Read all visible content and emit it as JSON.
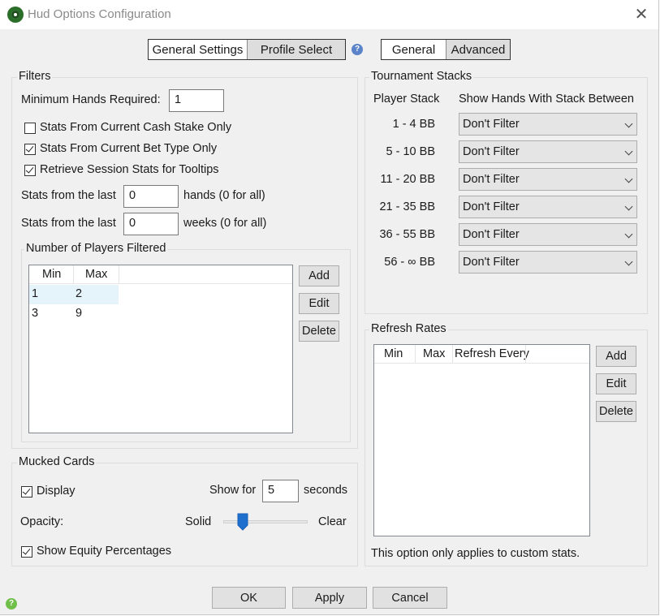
{
  "window": {
    "title": "Hud Options Configuration",
    "close_label": "✕"
  },
  "tabs_left": [
    {
      "label": "General Settings",
      "active": false
    },
    {
      "label": "Profile Select",
      "active": true
    }
  ],
  "tabs_right": [
    {
      "label": "General",
      "active": false
    },
    {
      "label": "Advanced",
      "active": true
    }
  ],
  "help_glyph": "?",
  "filters": {
    "title": "Filters",
    "min_hands_label": "Minimum Hands Required:",
    "min_hands_value": "1",
    "checkboxes": [
      {
        "label": "Stats From Current Cash Stake Only",
        "checked": false
      },
      {
        "label": "Stats From Current Bet Type Only",
        "checked": true
      },
      {
        "label": "Retrieve Session Stats for Tooltips",
        "checked": true
      }
    ],
    "last_hands_prefix": "Stats from the last",
    "last_hands_value": "0",
    "last_hands_suffix": "hands (0 for all)",
    "last_weeks_prefix": "Stats from the last",
    "last_weeks_value": "0",
    "last_weeks_suffix": "weeks (0 for all)"
  },
  "players_filtered": {
    "title": "Number of Players Filtered",
    "columns": [
      "Min",
      "Max"
    ],
    "rows": [
      {
        "min": "1",
        "max": "2",
        "selected": true
      },
      {
        "min": "3",
        "max": "9",
        "selected": false
      }
    ],
    "add": "Add",
    "edit": "Edit",
    "delete": "Delete"
  },
  "mucked": {
    "title": "Mucked Cards",
    "display_label": "Display",
    "display_checked": true,
    "show_for_label": "Show for",
    "show_for_value": "5",
    "seconds_label": "seconds",
    "opacity_label": "Opacity:",
    "solid_label": "Solid",
    "clear_label": "Clear",
    "opacity_fraction": 0.24,
    "equity_label": "Show Equity Percentages",
    "equity_checked": true
  },
  "tournament": {
    "title": "Tournament Stacks",
    "col_stack": "Player Stack",
    "col_show": "Show Hands With Stack Between",
    "rows": [
      {
        "stack": "1 - 4 BB",
        "value": "Don't Filter"
      },
      {
        "stack": "5 - 10 BB",
        "value": "Don't Filter"
      },
      {
        "stack": "11 - 20 BB",
        "value": "Don't Filter"
      },
      {
        "stack": "21 - 35 BB",
        "value": "Don't Filter"
      },
      {
        "stack": "36 - 55 BB",
        "value": "Don't Filter"
      },
      {
        "stack": "56 - ∞ BB",
        "value": "Don't Filter"
      }
    ]
  },
  "refresh": {
    "title": "Refresh Rates",
    "columns": [
      "Min",
      "Max",
      "Refresh Every"
    ],
    "add": "Add",
    "edit": "Edit",
    "delete": "Delete",
    "note": "This option only applies to custom stats."
  },
  "footer": {
    "ok": "OK",
    "apply": "Apply",
    "cancel": "Cancel",
    "status_glyph": "?"
  },
  "colors": {
    "window_bg": "#f0f0f0",
    "selection": "#e5f3fb",
    "slider_thumb": "#1f6fcf",
    "help_blue": "#5b83c9",
    "status_green": "#6fbf4a"
  }
}
